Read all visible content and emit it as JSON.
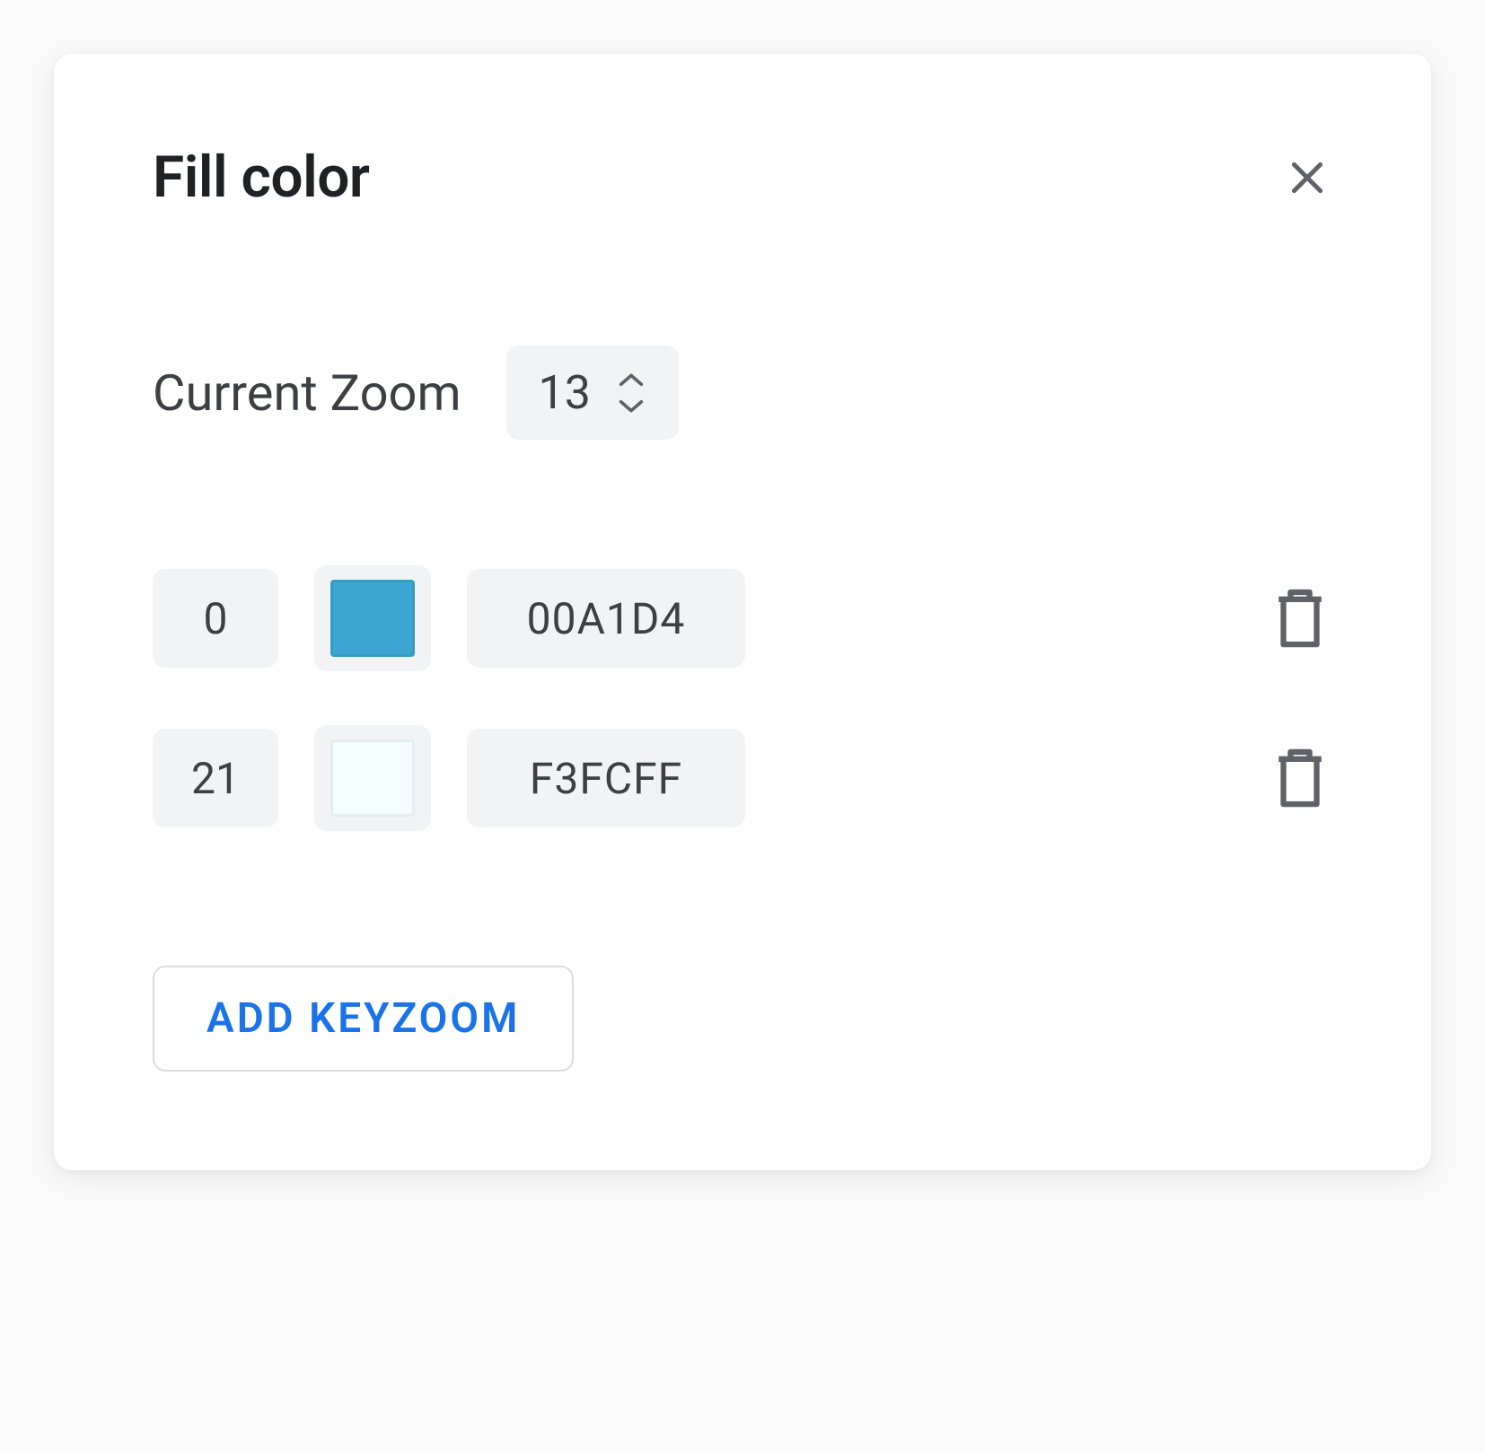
{
  "panel": {
    "title": "Fill color",
    "zoom_label": "Current Zoom",
    "zoom_value": "13",
    "add_button_label": "ADD KEYZOOM"
  },
  "keyzooms": [
    {
      "index": "0",
      "hex": "00A1D4",
      "color": "#3ca5d1"
    },
    {
      "index": "21",
      "hex": "F3FCFF",
      "color": "#f3fcff"
    }
  ]
}
